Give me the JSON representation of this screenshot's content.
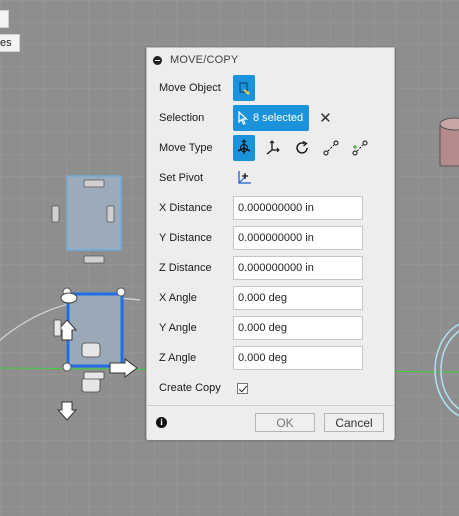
{
  "dialog": {
    "title": "MOVE/COPY",
    "rows": {
      "move_object": {
        "label": "Move Object"
      },
      "selection": {
        "label": "Selection",
        "button_text": "8 selected",
        "clear_glyph": "✕"
      },
      "move_type": {
        "label": "Move Type"
      },
      "set_pivot": {
        "label": "Set Pivot"
      },
      "x_distance": {
        "label": "X Distance",
        "value": "0.000000000 in"
      },
      "y_distance": {
        "label": "Y Distance",
        "value": "0.000000000 in"
      },
      "z_distance": {
        "label": "Z Distance",
        "value": "0.000000000 in"
      },
      "x_angle": {
        "label": "X Angle",
        "value": "0.000 deg"
      },
      "y_angle": {
        "label": "Y Angle",
        "value": "0.000 deg"
      },
      "z_angle": {
        "label": "Z Angle",
        "value": "0.000 deg"
      },
      "create_copy": {
        "label": "Create Copy",
        "checked": true
      }
    },
    "footer": {
      "info_glyph": "i",
      "ok_label": "OK",
      "cancel_label": "Cancel"
    }
  },
  "toolbar_fragment": {
    "chip_text": "es"
  },
  "colors": {
    "accent": "#1b93dc",
    "viewport_bg": "#8f8f8f",
    "selection_highlight": "#1e6fe6",
    "axis_green": "#3bd13b"
  },
  "icons": [
    "collapse-icon",
    "body-select-icon",
    "cursor-arrow-icon",
    "clear-selection-icon",
    "free-move-icon",
    "translate-icon",
    "rotate-icon",
    "point-to-point-icon",
    "point-to-position-icon",
    "pivot-icon",
    "info-icon"
  ]
}
